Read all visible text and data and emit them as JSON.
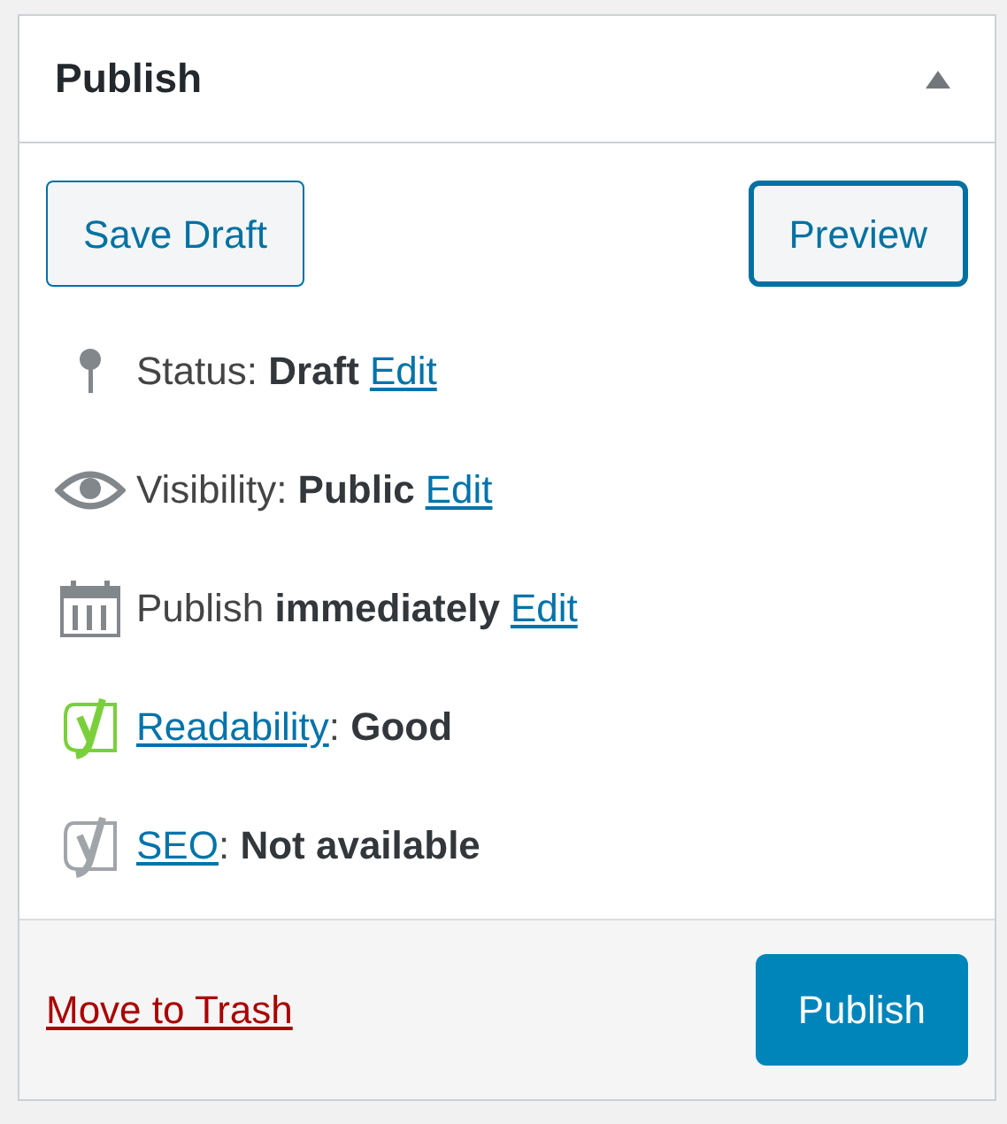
{
  "panel": {
    "title": "Publish",
    "expanded": true
  },
  "buttons": [
    {
      "label": "Save Draft",
      "kind": "secondary"
    },
    {
      "label": "Preview",
      "kind": "focused"
    }
  ],
  "misc": [
    {
      "kind": "pin",
      "text": "Status: **Draft**",
      "link": "Edit"
    },
    {
      "kind": "eye",
      "text": "Visibility: **Public**",
      "link": "Edit"
    },
    {
      "kind": "calendar",
      "text": "Publish **immediately**",
      "link": "Edit"
    },
    {
      "kind": "yoast",
      "color": "#7ad03a",
      "link": "Readability",
      "text": ": **Good**"
    },
    {
      "kind": "yoast",
      "color": "#a0a5aa",
      "link": "SEO",
      "text": ": **Not available**"
    }
  ],
  "footer": {
    "trash_link": "Move to Trash",
    "publish_button": "Publish"
  }
}
